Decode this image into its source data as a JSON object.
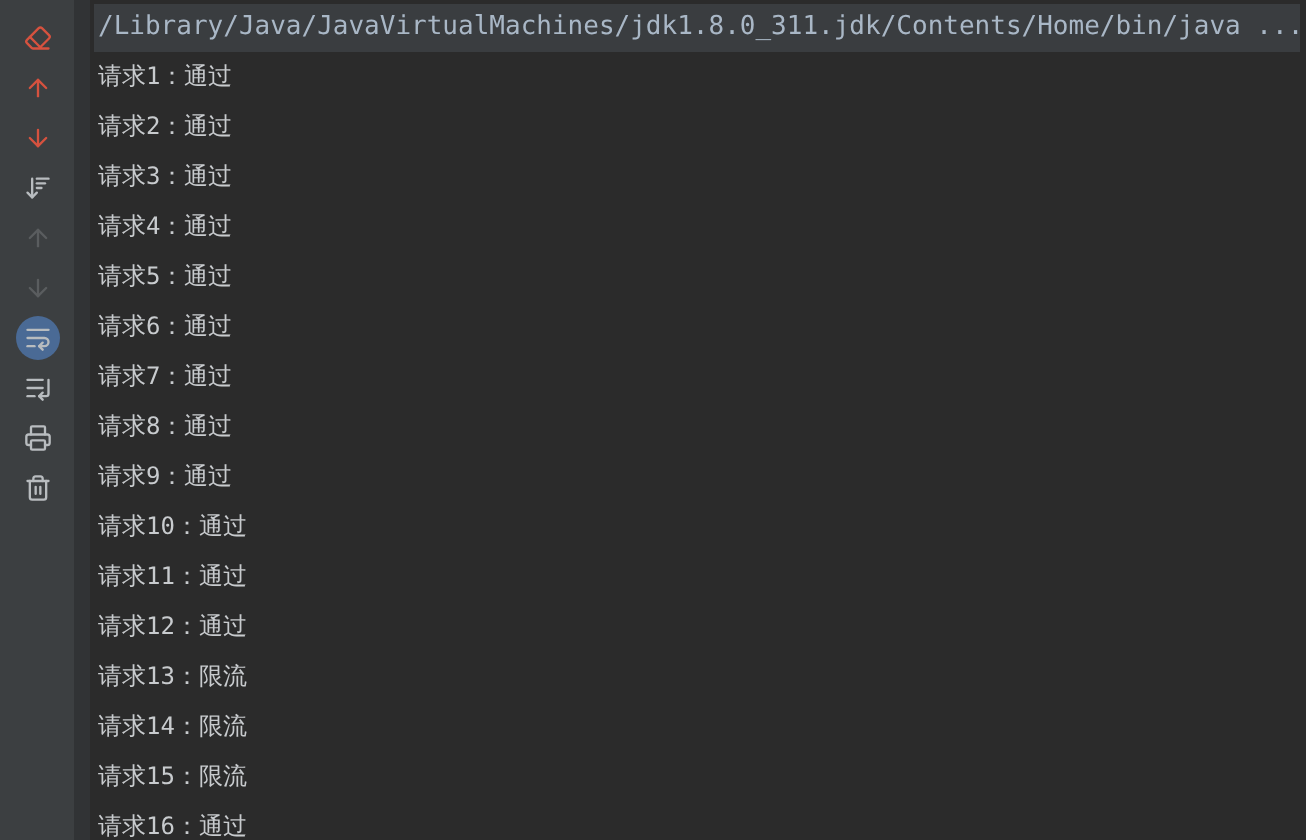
{
  "toolbar": [
    {
      "kind": "clear",
      "selected": false,
      "disabled": false
    },
    {
      "kind": "up-stack",
      "selected": false,
      "disabled": false
    },
    {
      "kind": "down-stack",
      "selected": false,
      "disabled": false
    },
    {
      "kind": "sort",
      "selected": false,
      "disabled": false
    },
    {
      "kind": "up",
      "selected": false,
      "disabled": true
    },
    {
      "kind": "down",
      "selected": false,
      "disabled": true
    },
    {
      "kind": "wrap",
      "selected": true,
      "disabled": false
    },
    {
      "kind": "scroll-end",
      "selected": false,
      "disabled": false
    },
    {
      "kind": "print",
      "selected": false,
      "disabled": false
    },
    {
      "kind": "trash",
      "selected": false,
      "disabled": false
    }
  ],
  "console": {
    "command": "/Library/Java/JavaVirtualMachines/jdk1.8.0_311.jdk/Contents/Home/bin/java ...",
    "lines": [
      "请求1：通过",
      "请求2：通过",
      "请求3：通过",
      "请求4：通过",
      "请求5：通过",
      "请求6：通过",
      "请求7：通过",
      "请求8：通过",
      "请求9：通过",
      "请求10：通过",
      "请求11：通过",
      "请求12：通过",
      "请求13：限流",
      "请求14：限流",
      "请求15：限流",
      "请求16：通过"
    ]
  }
}
